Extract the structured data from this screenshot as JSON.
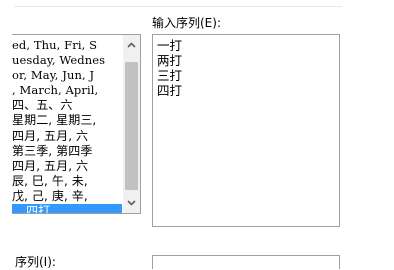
{
  "custom_lists": {
    "items": [
      "ed, Thu, Fri, S",
      "uesday, Wednes",
      "or, May, Jun, J",
      ", March, April,",
      "四、五、六",
      "星期二, 星期三,",
      "四月, 五月, 六",
      "第三季, 第四季",
      "四月, 五月, 六",
      "辰, 巳, 午, 未,",
      "戊, 己, 庚, 辛,",
      "四打"
    ],
    "selected_index": 11
  },
  "entries": {
    "label": "输入序列(E):",
    "lines": [
      "一打",
      "两打",
      "三打",
      "四打"
    ]
  },
  "import": {
    "label": "序列(I):"
  },
  "icons": {
    "scroll_up": "chevron-up-icon",
    "scroll_down": "chevron-down-icon"
  }
}
